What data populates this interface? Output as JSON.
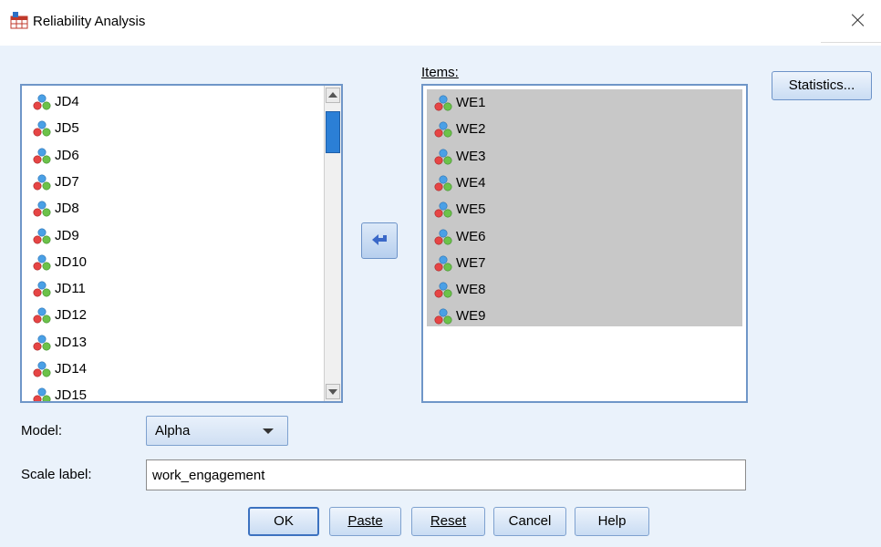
{
  "window": {
    "title": "Reliability Analysis",
    "icon": "table-icon"
  },
  "source_list": {
    "items": [
      "JD4",
      "JD5",
      "JD6",
      "JD7",
      "JD8",
      "JD9",
      "JD10",
      "JD11",
      "JD12",
      "JD13",
      "JD14",
      "JD15"
    ],
    "item_icon": "scale-variable-icon"
  },
  "move_button": {
    "icon": "arrow-left-icon"
  },
  "items_list": {
    "label": "Items:",
    "items": [
      "WE1",
      "WE2",
      "WE3",
      "WE4",
      "WE5",
      "WE6",
      "WE7",
      "WE8",
      "WE9"
    ],
    "selected_background": "#c8c8c8"
  },
  "statistics_button": {
    "label": "Statistics..."
  },
  "model": {
    "label": "Model:",
    "value": "Alpha"
  },
  "scale_label": {
    "label": "Scale label:",
    "value": "work_engagement"
  },
  "footer": {
    "ok": "OK",
    "paste": "Paste",
    "reset": "Reset",
    "cancel": "Cancel",
    "help": "Help"
  },
  "colors": {
    "dialog_background": "#eaf2fb",
    "list_border": "#6f96c8",
    "scroll_thumb": "#2b7fd6",
    "accent_button": "#3c72c0"
  }
}
